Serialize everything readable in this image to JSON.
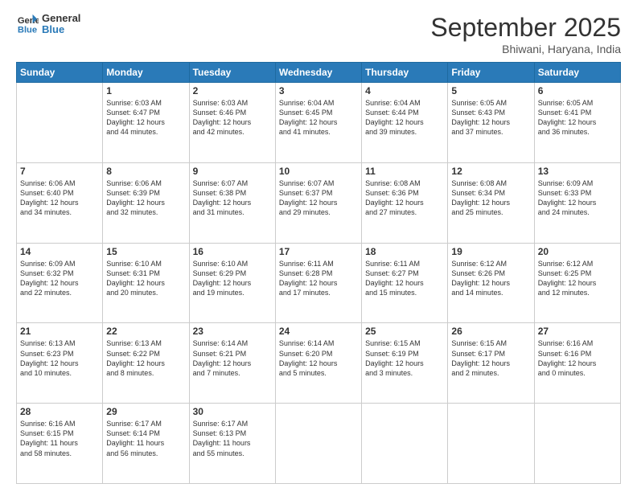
{
  "logo": {
    "line1": "General",
    "line2": "Blue"
  },
  "title": "September 2025",
  "subtitle": "Bhiwani, Haryana, India",
  "days_of_week": [
    "Sunday",
    "Monday",
    "Tuesday",
    "Wednesday",
    "Thursday",
    "Friday",
    "Saturday"
  ],
  "weeks": [
    [
      {
        "day": "",
        "info": ""
      },
      {
        "day": "1",
        "info": "Sunrise: 6:03 AM\nSunset: 6:47 PM\nDaylight: 12 hours\nand 44 minutes."
      },
      {
        "day": "2",
        "info": "Sunrise: 6:03 AM\nSunset: 6:46 PM\nDaylight: 12 hours\nand 42 minutes."
      },
      {
        "day": "3",
        "info": "Sunrise: 6:04 AM\nSunset: 6:45 PM\nDaylight: 12 hours\nand 41 minutes."
      },
      {
        "day": "4",
        "info": "Sunrise: 6:04 AM\nSunset: 6:44 PM\nDaylight: 12 hours\nand 39 minutes."
      },
      {
        "day": "5",
        "info": "Sunrise: 6:05 AM\nSunset: 6:43 PM\nDaylight: 12 hours\nand 37 minutes."
      },
      {
        "day": "6",
        "info": "Sunrise: 6:05 AM\nSunset: 6:41 PM\nDaylight: 12 hours\nand 36 minutes."
      }
    ],
    [
      {
        "day": "7",
        "info": "Sunrise: 6:06 AM\nSunset: 6:40 PM\nDaylight: 12 hours\nand 34 minutes."
      },
      {
        "day": "8",
        "info": "Sunrise: 6:06 AM\nSunset: 6:39 PM\nDaylight: 12 hours\nand 32 minutes."
      },
      {
        "day": "9",
        "info": "Sunrise: 6:07 AM\nSunset: 6:38 PM\nDaylight: 12 hours\nand 31 minutes."
      },
      {
        "day": "10",
        "info": "Sunrise: 6:07 AM\nSunset: 6:37 PM\nDaylight: 12 hours\nand 29 minutes."
      },
      {
        "day": "11",
        "info": "Sunrise: 6:08 AM\nSunset: 6:36 PM\nDaylight: 12 hours\nand 27 minutes."
      },
      {
        "day": "12",
        "info": "Sunrise: 6:08 AM\nSunset: 6:34 PM\nDaylight: 12 hours\nand 25 minutes."
      },
      {
        "day": "13",
        "info": "Sunrise: 6:09 AM\nSunset: 6:33 PM\nDaylight: 12 hours\nand 24 minutes."
      }
    ],
    [
      {
        "day": "14",
        "info": "Sunrise: 6:09 AM\nSunset: 6:32 PM\nDaylight: 12 hours\nand 22 minutes."
      },
      {
        "day": "15",
        "info": "Sunrise: 6:10 AM\nSunset: 6:31 PM\nDaylight: 12 hours\nand 20 minutes."
      },
      {
        "day": "16",
        "info": "Sunrise: 6:10 AM\nSunset: 6:29 PM\nDaylight: 12 hours\nand 19 minutes."
      },
      {
        "day": "17",
        "info": "Sunrise: 6:11 AM\nSunset: 6:28 PM\nDaylight: 12 hours\nand 17 minutes."
      },
      {
        "day": "18",
        "info": "Sunrise: 6:11 AM\nSunset: 6:27 PM\nDaylight: 12 hours\nand 15 minutes."
      },
      {
        "day": "19",
        "info": "Sunrise: 6:12 AM\nSunset: 6:26 PM\nDaylight: 12 hours\nand 14 minutes."
      },
      {
        "day": "20",
        "info": "Sunrise: 6:12 AM\nSunset: 6:25 PM\nDaylight: 12 hours\nand 12 minutes."
      }
    ],
    [
      {
        "day": "21",
        "info": "Sunrise: 6:13 AM\nSunset: 6:23 PM\nDaylight: 12 hours\nand 10 minutes."
      },
      {
        "day": "22",
        "info": "Sunrise: 6:13 AM\nSunset: 6:22 PM\nDaylight: 12 hours\nand 8 minutes."
      },
      {
        "day": "23",
        "info": "Sunrise: 6:14 AM\nSunset: 6:21 PM\nDaylight: 12 hours\nand 7 minutes."
      },
      {
        "day": "24",
        "info": "Sunrise: 6:14 AM\nSunset: 6:20 PM\nDaylight: 12 hours\nand 5 minutes."
      },
      {
        "day": "25",
        "info": "Sunrise: 6:15 AM\nSunset: 6:19 PM\nDaylight: 12 hours\nand 3 minutes."
      },
      {
        "day": "26",
        "info": "Sunrise: 6:15 AM\nSunset: 6:17 PM\nDaylight: 12 hours\nand 2 minutes."
      },
      {
        "day": "27",
        "info": "Sunrise: 6:16 AM\nSunset: 6:16 PM\nDaylight: 12 hours\nand 0 minutes."
      }
    ],
    [
      {
        "day": "28",
        "info": "Sunrise: 6:16 AM\nSunset: 6:15 PM\nDaylight: 11 hours\nand 58 minutes."
      },
      {
        "day": "29",
        "info": "Sunrise: 6:17 AM\nSunset: 6:14 PM\nDaylight: 11 hours\nand 56 minutes."
      },
      {
        "day": "30",
        "info": "Sunrise: 6:17 AM\nSunset: 6:13 PM\nDaylight: 11 hours\nand 55 minutes."
      },
      {
        "day": "",
        "info": ""
      },
      {
        "day": "",
        "info": ""
      },
      {
        "day": "",
        "info": ""
      },
      {
        "day": "",
        "info": ""
      }
    ]
  ]
}
